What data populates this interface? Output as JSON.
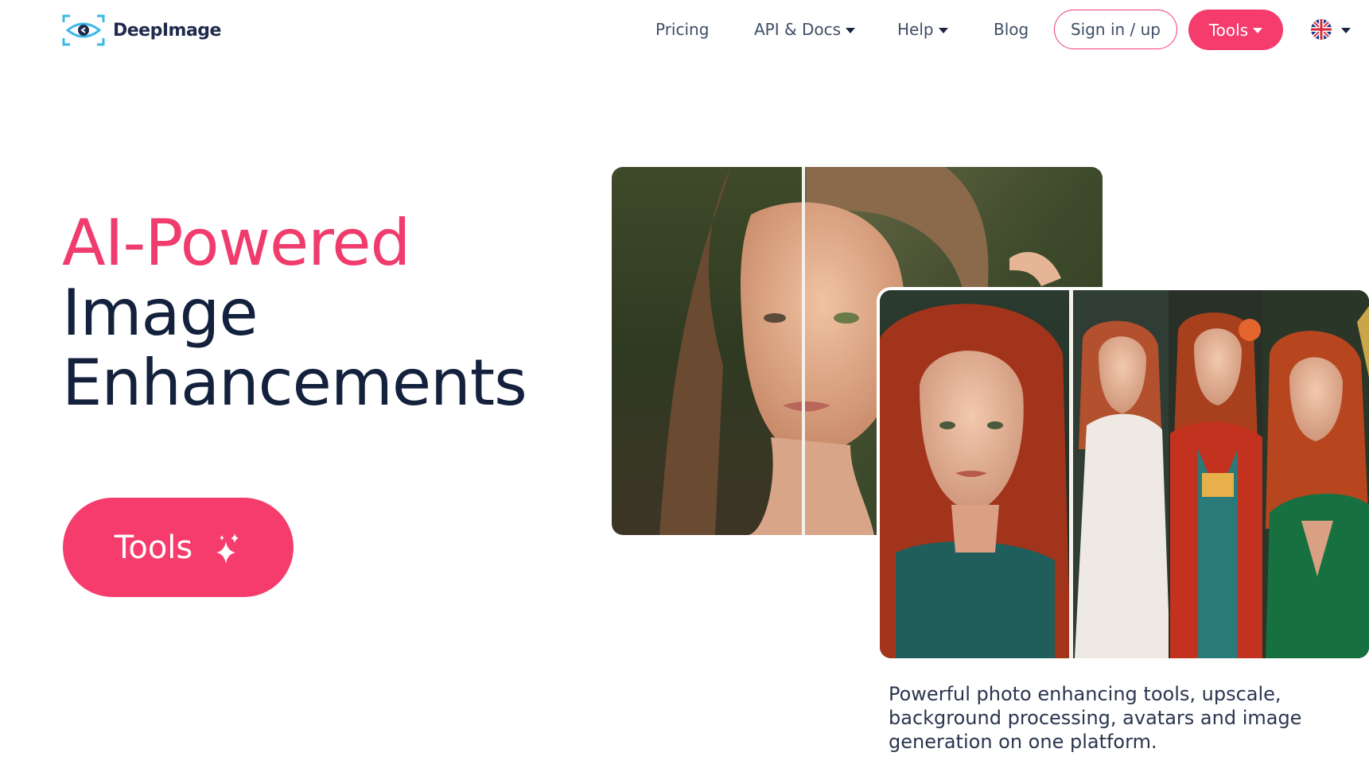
{
  "header": {
    "logo_text": "DeepImage",
    "nav": {
      "pricing": "Pricing",
      "api_docs": "API & Docs",
      "help": "Help",
      "blog": "Blog"
    },
    "signin_label": "Sign in / up",
    "tools_label": "Tools",
    "language_icon": "uk-flag-icon"
  },
  "hero": {
    "title_line1": "AI-Powered",
    "title_line2": "Image",
    "title_line3": "Enhancements",
    "cta_label": "Tools",
    "cta_icon": "sparkle-icon"
  },
  "caption": "Powerful photo enhancing tools, upscale, background processing, avatars and image generation on one platform.",
  "colors": {
    "accent": "#f53c6d",
    "heading": "#14213d",
    "logo_cyan": "#3bb8e8"
  }
}
